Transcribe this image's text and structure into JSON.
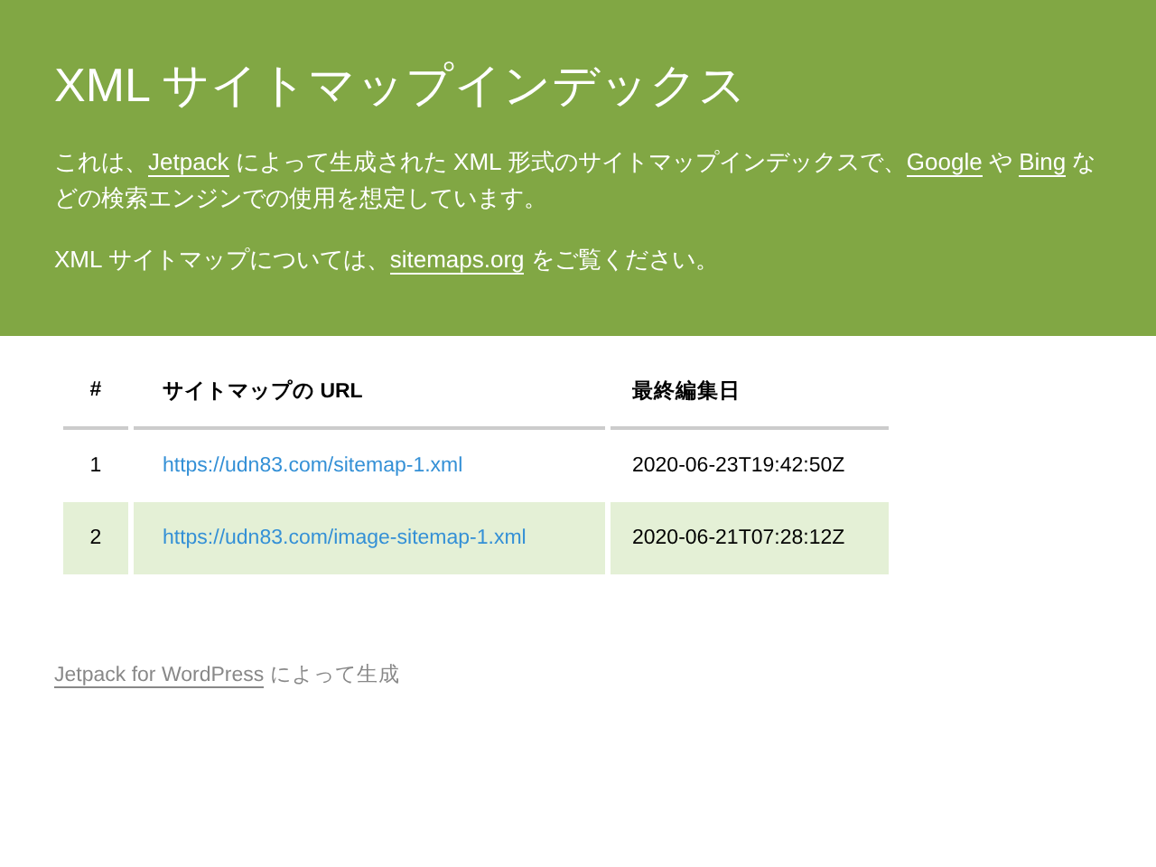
{
  "header": {
    "title": "XML サイトマップインデックス",
    "paragraphs": [
      [
        {
          "kind": "text",
          "text": "これは、"
        },
        {
          "kind": "link",
          "text": "Jetpack"
        },
        {
          "kind": "text",
          "text": " によって生成された XML 形式のサイトマップインデックスで、"
        },
        {
          "kind": "link",
          "text": "Google"
        },
        {
          "kind": "text",
          "text": " や "
        },
        {
          "kind": "link",
          "text": "Bing"
        },
        {
          "kind": "text",
          "text": " などの検索エンジンでの使用を想定しています。"
        }
      ],
      [
        {
          "kind": "text",
          "text": "XML サイトマップについては、"
        },
        {
          "kind": "link",
          "text": "sitemaps.org"
        },
        {
          "kind": "text",
          "text": " をご覧ください。"
        }
      ]
    ]
  },
  "table": {
    "columns": [
      "#",
      "サイトマップの URL",
      "最終編集日"
    ],
    "rows": [
      {
        "number": "1",
        "url": "https://udn83.com/sitemap-1.xml",
        "date": "2020-06-23T19:42:50Z"
      },
      {
        "number": "2",
        "url": "https://udn83.com/image-sitemap-1.xml",
        "date": "2020-06-21T07:28:12Z"
      }
    ]
  },
  "footer": {
    "link": "Jetpack for WordPress",
    "text": "によって生成"
  }
}
